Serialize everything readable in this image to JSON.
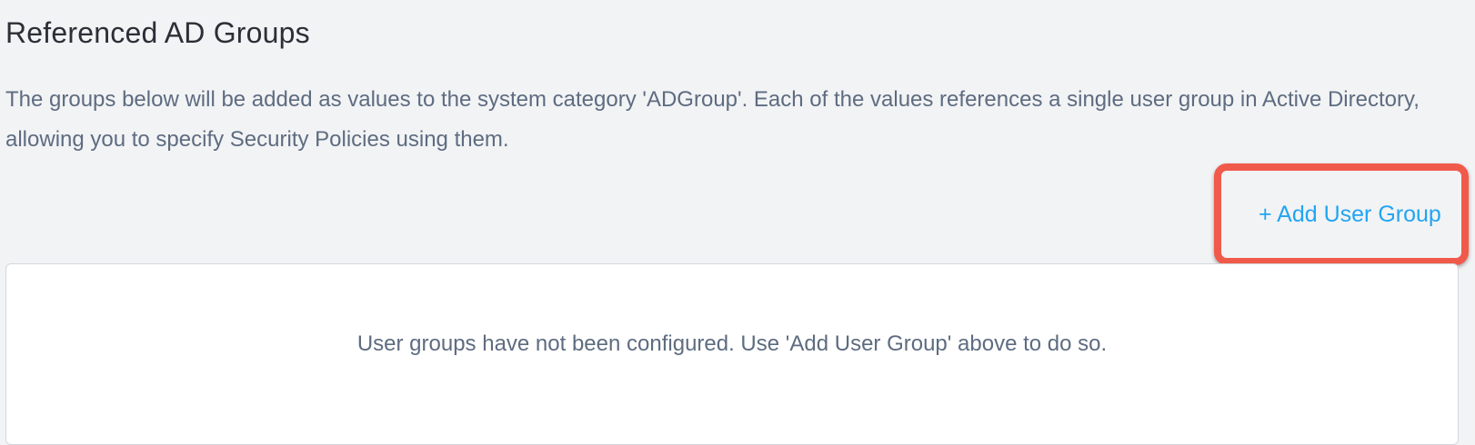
{
  "section": {
    "title": "Referenced AD Groups",
    "description": "The groups below will be added as values to the system category 'ADGroup'. Each of the values references a single user group in Active Directory, allowing you to specify Security Policies using them."
  },
  "actions": {
    "add_user_group_label": "+ Add User Group"
  },
  "user_groups": {
    "empty_message": "User groups have not been configured. Use 'Add User Group' above to do so."
  },
  "colors": {
    "background": "#f2f3f5",
    "title_text": "#2b2f36",
    "body_text": "#5e6c80",
    "link_accent": "#22a5f1",
    "highlight_annotation": "#f05a4a",
    "panel_background": "#ffffff",
    "panel_border": "#d3d7dd"
  }
}
